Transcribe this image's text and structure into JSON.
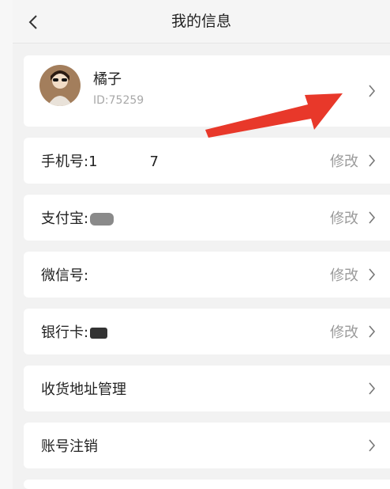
{
  "header": {
    "title": "我的信息",
    "back_icon": "chevron-left-icon"
  },
  "profile": {
    "nickname": "橘子",
    "user_id": "ID:75259",
    "chevron_icon": "chevron-right-icon"
  },
  "rows": [
    {
      "label_prefix": "手机号:1",
      "label_suffix": "7",
      "action": "修改"
    },
    {
      "label_prefix": "支付宝:",
      "label_suffix": "",
      "action": "修改"
    },
    {
      "label_prefix": "微信号:",
      "label_suffix": "",
      "action": "修改"
    },
    {
      "label_prefix": "银行卡:",
      "label_suffix": "",
      "action": "修改"
    },
    {
      "label_prefix": "收货地址管理",
      "label_suffix": "",
      "action": ""
    },
    {
      "label_prefix": "账号注销",
      "label_suffix": "",
      "action": ""
    }
  ],
  "colors": {
    "annotation_arrow": "#e8382a",
    "background": "#f2f2f2",
    "card": "#ffffff"
  }
}
